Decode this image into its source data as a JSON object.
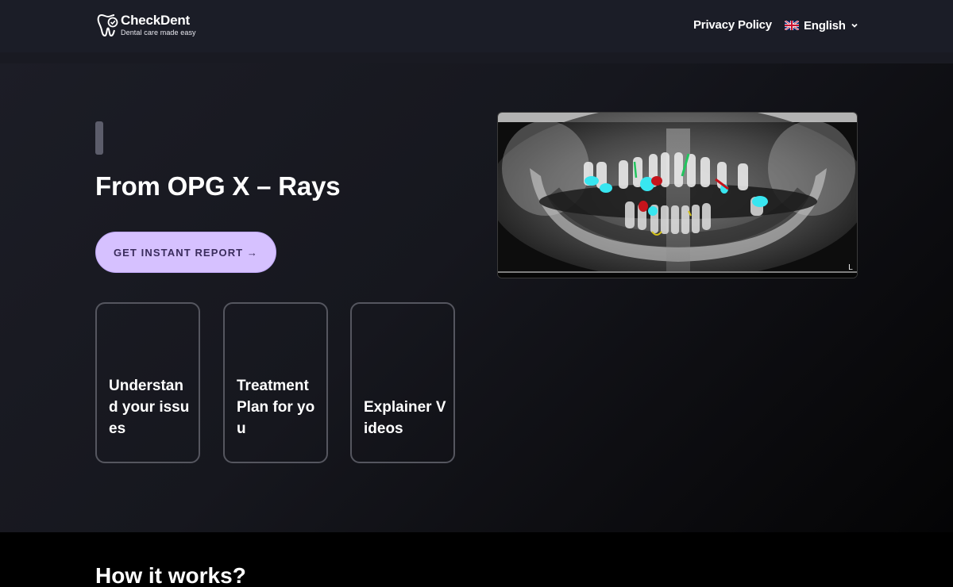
{
  "header": {
    "logo": {
      "name": "CheckDent",
      "tagline": "Dental care made easy",
      "icon": "tooth-icon"
    },
    "nav": {
      "privacy_label": "Privacy Policy",
      "language_label": "English",
      "language_flag": "uk-flag-icon"
    }
  },
  "hero": {
    "title": "From OPG X – Rays",
    "cta_label": "GET INSTANT REPORT →",
    "cards": [
      {
        "label": "Understand your issues"
      },
      {
        "label": "Treatment Plan for you"
      },
      {
        "label": "Explainer Videos"
      }
    ],
    "xray_corner_mark": "L"
  },
  "section": {
    "title": "How it works?"
  },
  "colors": {
    "header_bg": "#1b1d27",
    "cta_bg": "#d6c1ff",
    "cta_text": "#3a2c5c",
    "card_border": "#55565f",
    "highlight_cyan": "#38e6f0",
    "highlight_red": "#c4141c",
    "highlight_green": "#22c55e",
    "highlight_yellow": "#d4c21a"
  }
}
